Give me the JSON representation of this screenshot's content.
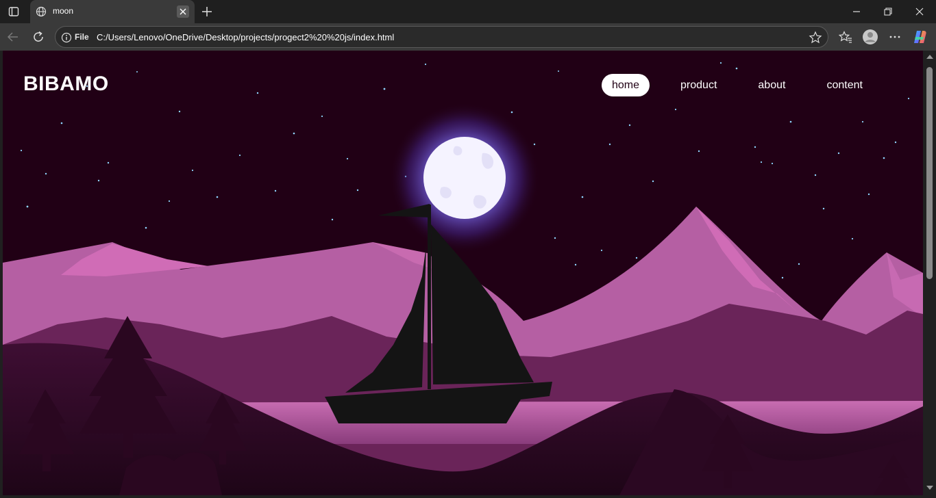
{
  "browser": {
    "tab": {
      "title": "moon",
      "favicon": "globe-icon",
      "close": "close-icon"
    },
    "new_tab_icon": "plus-icon",
    "window_controls": [
      "minimize-icon",
      "restore-icon",
      "close-icon"
    ],
    "toolbar": {
      "back_icon": "arrow-left-icon",
      "reload_icon": "reload-icon",
      "address": {
        "scheme_label": "File",
        "url": "C:/Users/Lenovo/OneDrive/Desktop/projects/progect2%20%20js/index.html"
      },
      "icons": [
        "star-icon",
        "favorites-icon",
        "profile-icon",
        "more-icon",
        "copilot-icon"
      ]
    }
  },
  "page": {
    "logo": "BIBAMO",
    "nav": [
      {
        "label": "home",
        "active": true
      },
      {
        "label": "product",
        "active": false
      },
      {
        "label": "about",
        "active": false
      },
      {
        "label": "content",
        "active": false
      }
    ]
  },
  "colors": {
    "sky": "#210015",
    "moon": "#f5f3ff",
    "moon_glow": "#6b5bd6",
    "mountain_far": "#b55fa3",
    "mountain_peak": "#d06cb6",
    "hill_mid": "#6a2459",
    "hill_dark": "#3a0d2f",
    "water": "#c268ac",
    "boat": "#141414"
  }
}
